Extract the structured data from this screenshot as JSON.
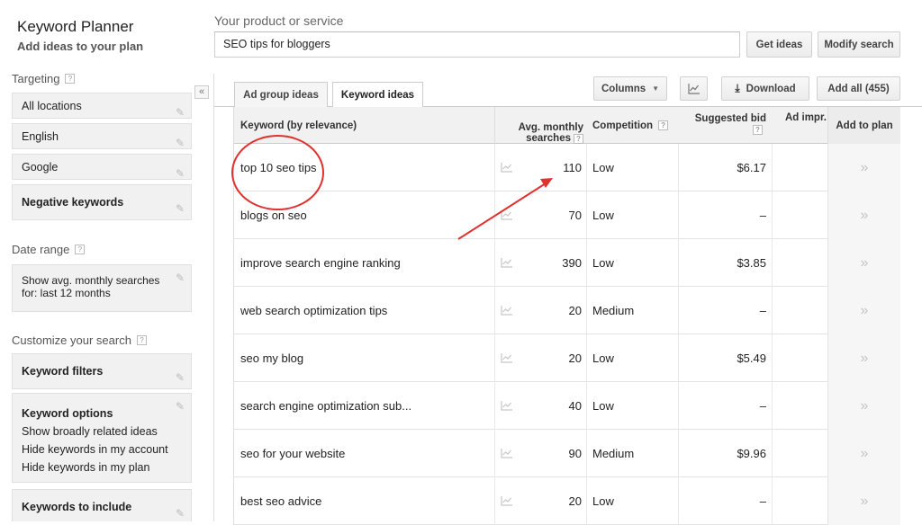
{
  "header": {
    "title": "Keyword Planner",
    "subtitle": "Add ideas to your plan",
    "product_label": "Your product or service",
    "product_value": "SEO tips for bloggers",
    "get_ideas": "Get ideas",
    "modify_search": "Modify search"
  },
  "sidebar": {
    "targeting_heading": "Targeting",
    "targeting": [
      "All locations",
      "English",
      "Google"
    ],
    "negative_keywords": "Negative keywords",
    "date_range_heading": "Date range",
    "date_range_line1": "Show avg. monthly searches",
    "date_range_line2": "for: last 12 months",
    "customize_heading": "Customize your search",
    "keyword_filters": "Keyword filters",
    "keyword_options": "Keyword options",
    "keyword_options_items": [
      "Show broadly related ideas",
      "Hide keywords in my account",
      "Hide keywords in my plan"
    ],
    "keywords_to_include": "Keywords to include",
    "collapse_symbol": "«"
  },
  "tabs": {
    "ad_group_ideas": "Ad group ideas",
    "keyword_ideas": "Keyword ideas"
  },
  "toolbar": {
    "columns": "Columns",
    "download": "Download",
    "add_all": "Add all (455)"
  },
  "table": {
    "headers": {
      "keyword": "Keyword (by relevance)",
      "avg_line1": "Avg. monthly",
      "avg_line2": "searches",
      "competition": "Competition",
      "suggested_bid": "Suggested bid",
      "ad_impr": "Ad impr.",
      "add_to_plan": "Add to plan"
    },
    "rows": [
      {
        "keyword": "top 10 seo tips",
        "avg": "110",
        "competition": "Low",
        "bid": "$6.17"
      },
      {
        "keyword": "blogs on seo",
        "avg": "70",
        "competition": "Low",
        "bid": "–"
      },
      {
        "keyword": "improve search engine ranking",
        "avg": "390",
        "competition": "Low",
        "bid": "$3.85"
      },
      {
        "keyword": "web search optimization tips",
        "avg": "20",
        "competition": "Medium",
        "bid": "–"
      },
      {
        "keyword": "seo my blog",
        "avg": "20",
        "competition": "Low",
        "bid": "$5.49"
      },
      {
        "keyword": "search engine optimization sub...",
        "avg": "40",
        "competition": "Low",
        "bid": "–"
      },
      {
        "keyword": "seo for your website",
        "avg": "90",
        "competition": "Medium",
        "bid": "$9.96"
      },
      {
        "keyword": "best seo advice",
        "avg": "20",
        "competition": "Low",
        "bid": "–"
      }
    ],
    "add_symbol": "»"
  },
  "colors": {
    "annotation": "#e0312f",
    "sidebar_box": "#f1f1f1"
  }
}
